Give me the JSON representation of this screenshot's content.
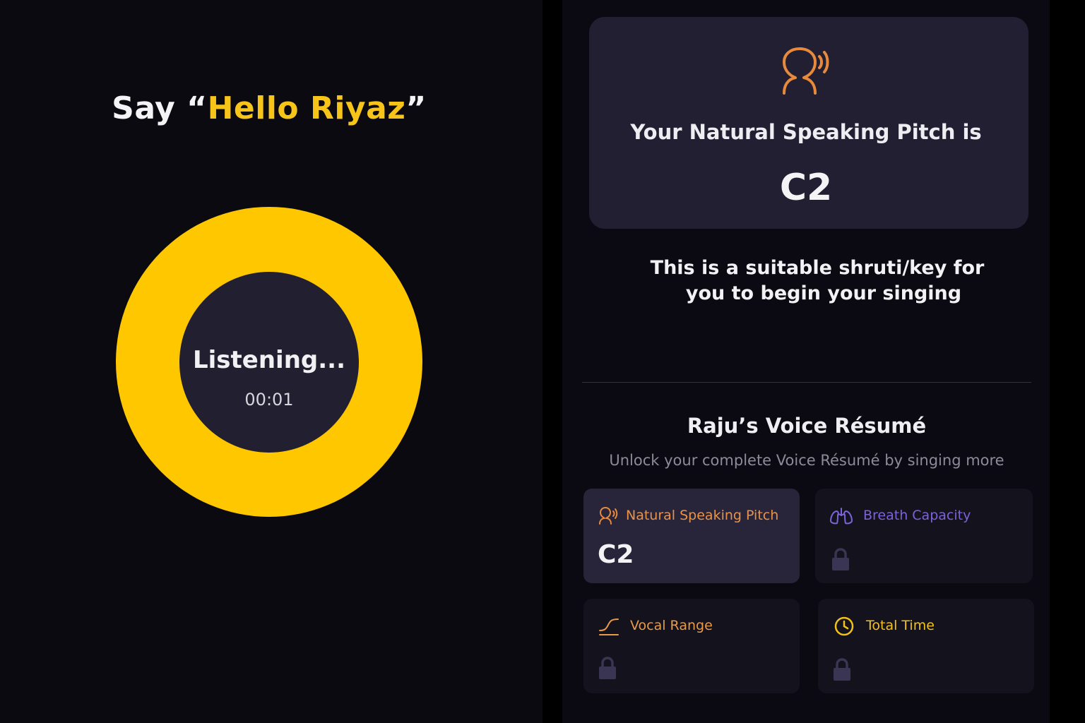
{
  "colors": {
    "accent_yellow": "#fec700",
    "pitch_orange": "#e88a3c",
    "breath_purple": "#7c63d8",
    "range_orange": "#e89a48",
    "time_yellow": "#f2c21a",
    "lock_purple": "#3a3552"
  },
  "listen": {
    "say_prefix": "Say “",
    "say_phrase": "Hello Riyaz",
    "say_suffix": "”",
    "status": "Listening...",
    "timer": "00:01"
  },
  "pitch": {
    "icon": "speaking-head-icon",
    "heading": "Your Natural Speaking Pitch is",
    "value": "C2",
    "suitable_line1": "This is a suitable shruti/key for",
    "suitable_line2": "you to begin your singing"
  },
  "resume": {
    "title": "Raju’s Voice Résumé",
    "subtitle": "Unlock your complete Voice Résumé by singing more",
    "cards": [
      {
        "label": "Natural Speaking Pitch",
        "value": "C2",
        "icon": "speaking-head-icon",
        "locked": false
      },
      {
        "label": "Breath Capacity",
        "icon": "lungs-icon",
        "locked": true
      },
      {
        "label": "Vocal Range",
        "icon": "range-curve-icon",
        "locked": true
      },
      {
        "label": "Total Time",
        "icon": "clock-icon",
        "locked": true
      }
    ]
  }
}
